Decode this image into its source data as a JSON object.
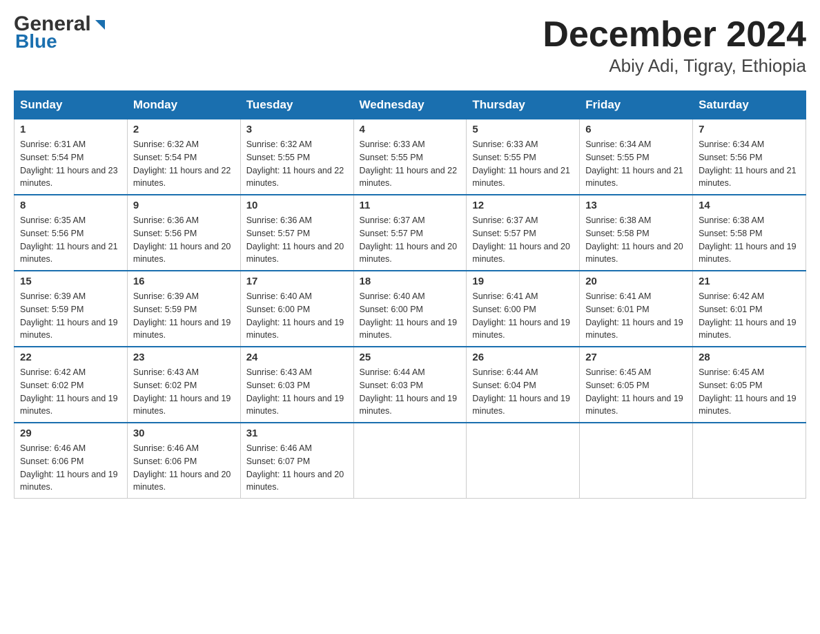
{
  "logo": {
    "text_general": "General",
    "text_blue": "Blue"
  },
  "title": {
    "month_year": "December 2024",
    "location": "Abiy Adi, Tigray, Ethiopia"
  },
  "headers": [
    "Sunday",
    "Monday",
    "Tuesday",
    "Wednesday",
    "Thursday",
    "Friday",
    "Saturday"
  ],
  "weeks": [
    [
      {
        "day": "1",
        "sunrise": "Sunrise: 6:31 AM",
        "sunset": "Sunset: 5:54 PM",
        "daylight": "Daylight: 11 hours and 23 minutes."
      },
      {
        "day": "2",
        "sunrise": "Sunrise: 6:32 AM",
        "sunset": "Sunset: 5:54 PM",
        "daylight": "Daylight: 11 hours and 22 minutes."
      },
      {
        "day": "3",
        "sunrise": "Sunrise: 6:32 AM",
        "sunset": "Sunset: 5:55 PM",
        "daylight": "Daylight: 11 hours and 22 minutes."
      },
      {
        "day": "4",
        "sunrise": "Sunrise: 6:33 AM",
        "sunset": "Sunset: 5:55 PM",
        "daylight": "Daylight: 11 hours and 22 minutes."
      },
      {
        "day": "5",
        "sunrise": "Sunrise: 6:33 AM",
        "sunset": "Sunset: 5:55 PM",
        "daylight": "Daylight: 11 hours and 21 minutes."
      },
      {
        "day": "6",
        "sunrise": "Sunrise: 6:34 AM",
        "sunset": "Sunset: 5:55 PM",
        "daylight": "Daylight: 11 hours and 21 minutes."
      },
      {
        "day": "7",
        "sunrise": "Sunrise: 6:34 AM",
        "sunset": "Sunset: 5:56 PM",
        "daylight": "Daylight: 11 hours and 21 minutes."
      }
    ],
    [
      {
        "day": "8",
        "sunrise": "Sunrise: 6:35 AM",
        "sunset": "Sunset: 5:56 PM",
        "daylight": "Daylight: 11 hours and 21 minutes."
      },
      {
        "day": "9",
        "sunrise": "Sunrise: 6:36 AM",
        "sunset": "Sunset: 5:56 PM",
        "daylight": "Daylight: 11 hours and 20 minutes."
      },
      {
        "day": "10",
        "sunrise": "Sunrise: 6:36 AM",
        "sunset": "Sunset: 5:57 PM",
        "daylight": "Daylight: 11 hours and 20 minutes."
      },
      {
        "day": "11",
        "sunrise": "Sunrise: 6:37 AM",
        "sunset": "Sunset: 5:57 PM",
        "daylight": "Daylight: 11 hours and 20 minutes."
      },
      {
        "day": "12",
        "sunrise": "Sunrise: 6:37 AM",
        "sunset": "Sunset: 5:57 PM",
        "daylight": "Daylight: 11 hours and 20 minutes."
      },
      {
        "day": "13",
        "sunrise": "Sunrise: 6:38 AM",
        "sunset": "Sunset: 5:58 PM",
        "daylight": "Daylight: 11 hours and 20 minutes."
      },
      {
        "day": "14",
        "sunrise": "Sunrise: 6:38 AM",
        "sunset": "Sunset: 5:58 PM",
        "daylight": "Daylight: 11 hours and 19 minutes."
      }
    ],
    [
      {
        "day": "15",
        "sunrise": "Sunrise: 6:39 AM",
        "sunset": "Sunset: 5:59 PM",
        "daylight": "Daylight: 11 hours and 19 minutes."
      },
      {
        "day": "16",
        "sunrise": "Sunrise: 6:39 AM",
        "sunset": "Sunset: 5:59 PM",
        "daylight": "Daylight: 11 hours and 19 minutes."
      },
      {
        "day": "17",
        "sunrise": "Sunrise: 6:40 AM",
        "sunset": "Sunset: 6:00 PM",
        "daylight": "Daylight: 11 hours and 19 minutes."
      },
      {
        "day": "18",
        "sunrise": "Sunrise: 6:40 AM",
        "sunset": "Sunset: 6:00 PM",
        "daylight": "Daylight: 11 hours and 19 minutes."
      },
      {
        "day": "19",
        "sunrise": "Sunrise: 6:41 AM",
        "sunset": "Sunset: 6:00 PM",
        "daylight": "Daylight: 11 hours and 19 minutes."
      },
      {
        "day": "20",
        "sunrise": "Sunrise: 6:41 AM",
        "sunset": "Sunset: 6:01 PM",
        "daylight": "Daylight: 11 hours and 19 minutes."
      },
      {
        "day": "21",
        "sunrise": "Sunrise: 6:42 AM",
        "sunset": "Sunset: 6:01 PM",
        "daylight": "Daylight: 11 hours and 19 minutes."
      }
    ],
    [
      {
        "day": "22",
        "sunrise": "Sunrise: 6:42 AM",
        "sunset": "Sunset: 6:02 PM",
        "daylight": "Daylight: 11 hours and 19 minutes."
      },
      {
        "day": "23",
        "sunrise": "Sunrise: 6:43 AM",
        "sunset": "Sunset: 6:02 PM",
        "daylight": "Daylight: 11 hours and 19 minutes."
      },
      {
        "day": "24",
        "sunrise": "Sunrise: 6:43 AM",
        "sunset": "Sunset: 6:03 PM",
        "daylight": "Daylight: 11 hours and 19 minutes."
      },
      {
        "day": "25",
        "sunrise": "Sunrise: 6:44 AM",
        "sunset": "Sunset: 6:03 PM",
        "daylight": "Daylight: 11 hours and 19 minutes."
      },
      {
        "day": "26",
        "sunrise": "Sunrise: 6:44 AM",
        "sunset": "Sunset: 6:04 PM",
        "daylight": "Daylight: 11 hours and 19 minutes."
      },
      {
        "day": "27",
        "sunrise": "Sunrise: 6:45 AM",
        "sunset": "Sunset: 6:05 PM",
        "daylight": "Daylight: 11 hours and 19 minutes."
      },
      {
        "day": "28",
        "sunrise": "Sunrise: 6:45 AM",
        "sunset": "Sunset: 6:05 PM",
        "daylight": "Daylight: 11 hours and 19 minutes."
      }
    ],
    [
      {
        "day": "29",
        "sunrise": "Sunrise: 6:46 AM",
        "sunset": "Sunset: 6:06 PM",
        "daylight": "Daylight: 11 hours and 19 minutes."
      },
      {
        "day": "30",
        "sunrise": "Sunrise: 6:46 AM",
        "sunset": "Sunset: 6:06 PM",
        "daylight": "Daylight: 11 hours and 20 minutes."
      },
      {
        "day": "31",
        "sunrise": "Sunrise: 6:46 AM",
        "sunset": "Sunset: 6:07 PM",
        "daylight": "Daylight: 11 hours and 20 minutes."
      },
      null,
      null,
      null,
      null
    ]
  ]
}
